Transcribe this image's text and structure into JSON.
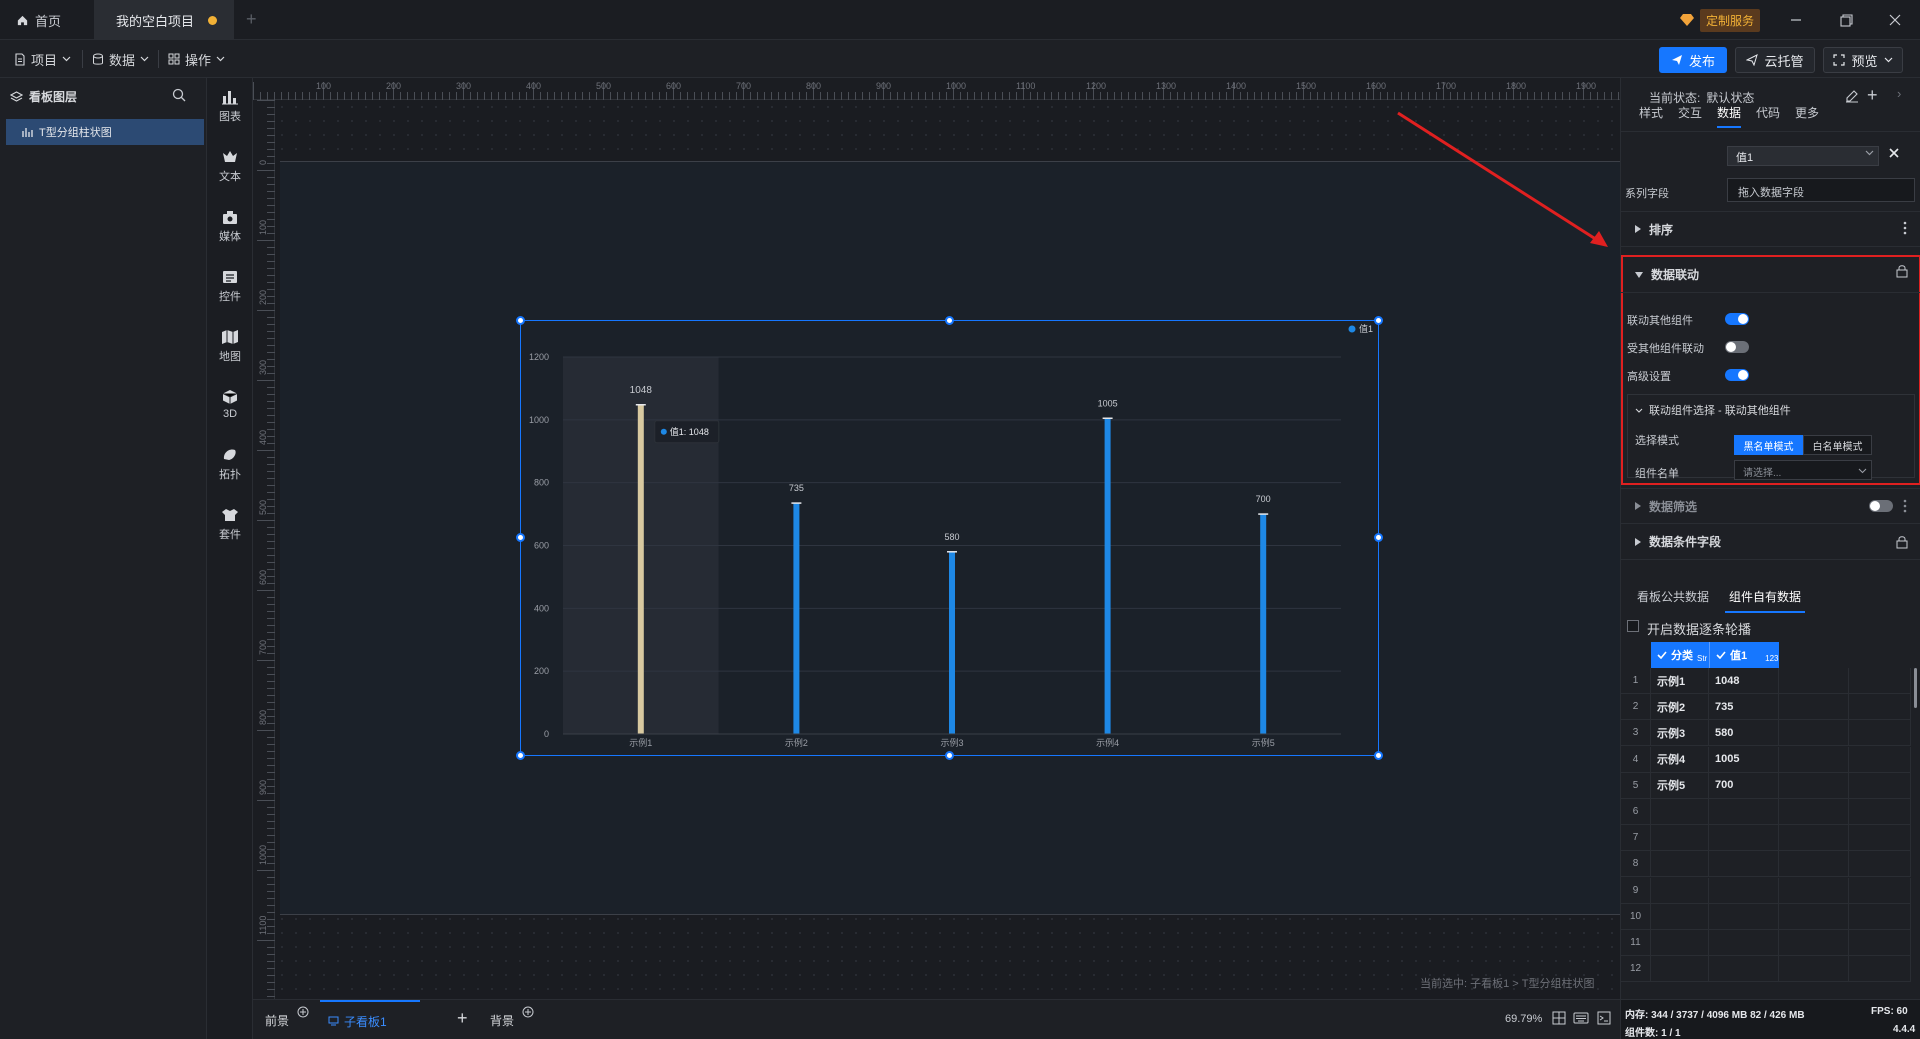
{
  "titlebar": {
    "home_tab": "首页",
    "project_tab": "我的空白项目",
    "custom_service": "定制服务"
  },
  "toolbar": {
    "menu_project": "项目",
    "menu_data": "数据",
    "menu_operation": "操作",
    "publish": "发布",
    "cloud_host": "云托管",
    "preview": "预览"
  },
  "layers": {
    "title": "看板图层",
    "items": [
      {
        "label": "T型分组柱状图"
      }
    ]
  },
  "iconbar": {
    "items": [
      {
        "label": "图表",
        "icon": "bar-chart-icon"
      },
      {
        "label": "文本",
        "icon": "text-icon"
      },
      {
        "label": "媒体",
        "icon": "media-icon"
      },
      {
        "label": "控件",
        "icon": "widget-icon"
      },
      {
        "label": "地图",
        "icon": "map-icon"
      },
      {
        "label": "3D",
        "icon": "cube-icon"
      },
      {
        "label": "拓扑",
        "icon": "topology-icon"
      },
      {
        "label": "套件",
        "icon": "kit-icon"
      }
    ]
  },
  "rulers": {
    "top": [
      "100",
      "200",
      "300",
      "400",
      "500",
      "600",
      "700",
      "800",
      "900",
      "1000",
      "1100",
      "1200",
      "1300",
      "1400",
      "1500",
      "1600",
      "1700",
      "1800",
      "1900"
    ],
    "left": [
      "0",
      "100",
      "200",
      "300",
      "400",
      "500",
      "600",
      "700",
      "800",
      "900",
      "1000",
      "1100"
    ]
  },
  "chart_data": {
    "type": "bar",
    "categories": [
      "示例1",
      "示例2",
      "示例3",
      "示例4",
      "示例5"
    ],
    "series": [
      {
        "name": "值1",
        "values": [
          1048,
          735,
          580,
          1005,
          700
        ],
        "color": "#1e88e5"
      }
    ],
    "highlight_color": "#d8c9a0",
    "ylim": [
      0,
      1200
    ],
    "yticks": [
      0,
      200,
      400,
      600,
      800,
      1000,
      1200
    ],
    "grid": true,
    "legend": "top-right",
    "tooltip": {
      "series": "值1",
      "value": "1048",
      "category_index": 0
    }
  },
  "canvas": {
    "status": "当前选中: 子看板1 > T型分组柱状图"
  },
  "bottombar": {
    "foreground": "前景",
    "subboard": "子看板1",
    "background": "背景",
    "zoom": "69.79%"
  },
  "rpanel": {
    "state_label": "当前状态:",
    "state_value": "默认状态",
    "tabs": [
      "样式",
      "交互",
      "数据",
      "代码",
      "更多"
    ],
    "active_tab": "数据",
    "value_field": "值1",
    "series_field_label": "系列字段",
    "series_field_placeholder": "拖入数据字段",
    "sort_label": "排序",
    "linkage_title": "数据联动",
    "link_others_label": "联动其他组件",
    "linked_by_others_label": "受其他组件联动",
    "advanced_label": "高级设置",
    "link_select_title": "联动组件选择 - 联动其他组件",
    "select_mode_label": "选择模式",
    "blacklist_mode": "黑名单模式",
    "whitelist_mode": "白名单模式",
    "component_list_label": "组件名单",
    "component_list_placeholder": "请选择...",
    "data_filter_label": "数据筛选",
    "data_condition_label": "数据条件字段",
    "data_tab_public": "看板公共数据",
    "data_tab_own": "组件自有数据",
    "carousel_label": "开启数据逐条轮播",
    "col_category": "分类",
    "col_category_type": "Str",
    "col_value": "值1",
    "col_value_type": "123",
    "rows": [
      {
        "num": "1",
        "cat": "示例1",
        "val": "1048"
      },
      {
        "num": "2",
        "cat": "示例2",
        "val": "735"
      },
      {
        "num": "3",
        "cat": "示例3",
        "val": "580"
      },
      {
        "num": "4",
        "cat": "示例4",
        "val": "1005"
      },
      {
        "num": "5",
        "cat": "示例5",
        "val": "700"
      },
      {
        "num": "6",
        "cat": "",
        "val": ""
      },
      {
        "num": "7",
        "cat": "",
        "val": ""
      },
      {
        "num": "8",
        "cat": "",
        "val": ""
      },
      {
        "num": "9",
        "cat": "",
        "val": ""
      },
      {
        "num": "10",
        "cat": "",
        "val": ""
      },
      {
        "num": "11",
        "cat": "",
        "val": ""
      },
      {
        "num": "12",
        "cat": "",
        "val": ""
      }
    ],
    "memory": "内存: 344 / 3737 / 4096 MB  82 / 426 MB",
    "fps": "FPS: 60",
    "component_count": "组件数: 1 / 1",
    "version": "4.4.4"
  }
}
